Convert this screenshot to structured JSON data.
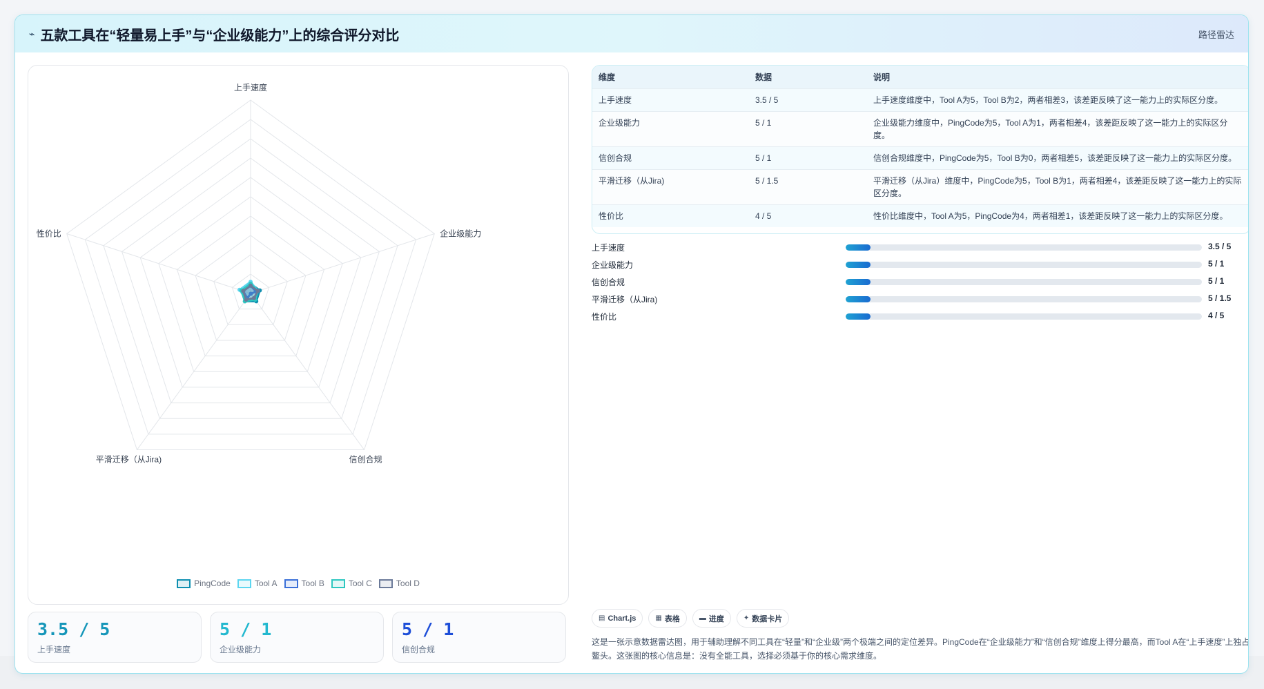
{
  "header": {
    "icon": "line-chart-icon",
    "title": "五款工具在“轻量易上手”与“企业级能力”上的综合评分对比",
    "tag": "路径雷达"
  },
  "chart_data": {
    "type": "radar",
    "axes": [
      "上手速度",
      "企业级能力",
      "信创合规",
      "平滑迁移（从Jira)",
      "性价比"
    ],
    "series": [
      {
        "name": "PingCode",
        "values": [
          0.05,
          0.05,
          0.05,
          0.05,
          0.05
        ],
        "color": "#0e8fb0"
      },
      {
        "name": "Tool A",
        "values": [
          0.06,
          0.04,
          0.03,
          0.04,
          0.06
        ],
        "color": "#5dd6f0"
      },
      {
        "name": "Tool B",
        "values": [
          0.04,
          0.03,
          0.0,
          0.03,
          0.04
        ],
        "color": "#3a6fd8"
      },
      {
        "name": "Tool C",
        "values": [
          0.05,
          0.04,
          0.04,
          0.05,
          0.05
        ],
        "color": "#2cc7c0"
      },
      {
        "name": "Tool D",
        "values": [
          0.04,
          0.04,
          0.03,
          0.04,
          0.04
        ],
        "color": "#6b7a99"
      }
    ],
    "rlim": [
      0,
      1
    ],
    "grid_levels": 10,
    "grid": true,
    "legend_position": "bottom"
  },
  "stats": [
    {
      "value": "3.5 / 5",
      "label": "上手速度",
      "color": "#1596b9"
    },
    {
      "value": "5 / 1",
      "label": "企业级能力",
      "color": "#22b8cf"
    },
    {
      "value": "5 / 1",
      "label": "信创合规",
      "color": "#1d4ed8"
    }
  ],
  "table": {
    "headers": [
      "维度",
      "数据",
      "说明"
    ],
    "rows": [
      [
        "上手速度",
        "3.5 / 5",
        "上手速度维度中，Tool A为5，Tool B为2，两者相差3，该差距反映了这一能力上的实际区分度。"
      ],
      [
        "企业级能力",
        "5 / 1",
        "企业级能力维度中，PingCode为5，Tool A为1，两者相差4，该差距反映了这一能力上的实际区分度。"
      ],
      [
        "信创合规",
        "5 / 1",
        "信创合规维度中，PingCode为5，Tool B为0，两者相差5，该差距反映了这一能力上的实际区分度。"
      ],
      [
        "平滑迁移（从Jira)",
        "5 / 1.5",
        "平滑迁移（从Jira）维度中，PingCode为5，Tool B为1，两者相差4，该差距反映了这一能力上的实际区分度。"
      ],
      [
        "性价比",
        "4 / 5",
        "性价比维度中，Tool A为5，PingCode为4，两者相差1，该差距反映了这一能力上的实际区分度。"
      ]
    ]
  },
  "progress": [
    {
      "label": "上手速度",
      "value": "3.5 / 5",
      "fraction": 0.07
    },
    {
      "label": "企业级能力",
      "value": "5 / 1",
      "fraction": 0.07
    },
    {
      "label": "信创合规",
      "value": "5 / 1",
      "fraction": 0.07
    },
    {
      "label": "平滑迁移（从Jira)",
      "value": "5 / 1.5",
      "fraction": 0.07
    },
    {
      "label": "性价比",
      "value": "4 / 5",
      "fraction": 0.07
    }
  ],
  "chips": [
    {
      "icon": "chart-icon",
      "glyph": "▤",
      "label": "Chart.js"
    },
    {
      "icon": "table-icon",
      "glyph": "▦",
      "label": "表格"
    },
    {
      "icon": "progress-icon",
      "glyph": "▬",
      "label": "进度"
    },
    {
      "icon": "sparkle-icon",
      "glyph": "✦",
      "label": "数据卡片"
    }
  ],
  "description": "这是一张示意数据雷达图，用于辅助理解不同工具在“轻量”和“企业级”两个极端之间的定位差异。PingCode在“企业级能力”和“信创合规”维度上得分最高，而Tool A在“上手速度”上独占鳌头。这张图的核心信息是：没有全能工具，选择必须基于你的核心需求维度。"
}
